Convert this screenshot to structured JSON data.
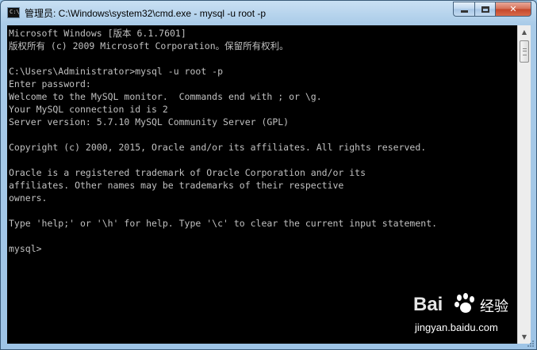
{
  "window": {
    "icon_text": "C:\\",
    "title": "管理员: C:\\Windows\\system32\\cmd.exe - mysql  -u root -p",
    "buttons": {
      "minimize": "minimize-icon",
      "maximize": "maximize-icon",
      "close": "✕"
    }
  },
  "console": {
    "lines": [
      "Microsoft Windows [版本 6.1.7601]",
      "版权所有 (c) 2009 Microsoft Corporation。保留所有权利。",
      "",
      "C:\\Users\\Administrator>mysql -u root -p",
      "Enter password:",
      "Welcome to the MySQL monitor.  Commands end with ; or \\g.",
      "Your MySQL connection id is 2",
      "Server version: 5.7.10 MySQL Community Server (GPL)",
      "",
      "Copyright (c) 2000, 2015, Oracle and/or its affiliates. All rights reserved.",
      "",
      "Oracle is a registered trademark of Oracle Corporation and/or its",
      "affiliates. Other names may be trademarks of their respective",
      "owners.",
      "",
      "Type 'help;' or '\\h' for help. Type '\\c' to clear the current input statement.",
      "",
      "mysql>"
    ]
  },
  "scrollbar": {
    "up": "▲",
    "down": "▼"
  },
  "watermark": {
    "logo": "Bai  ",
    "cn": "经验",
    "url": "jingyan.baidu.com"
  }
}
